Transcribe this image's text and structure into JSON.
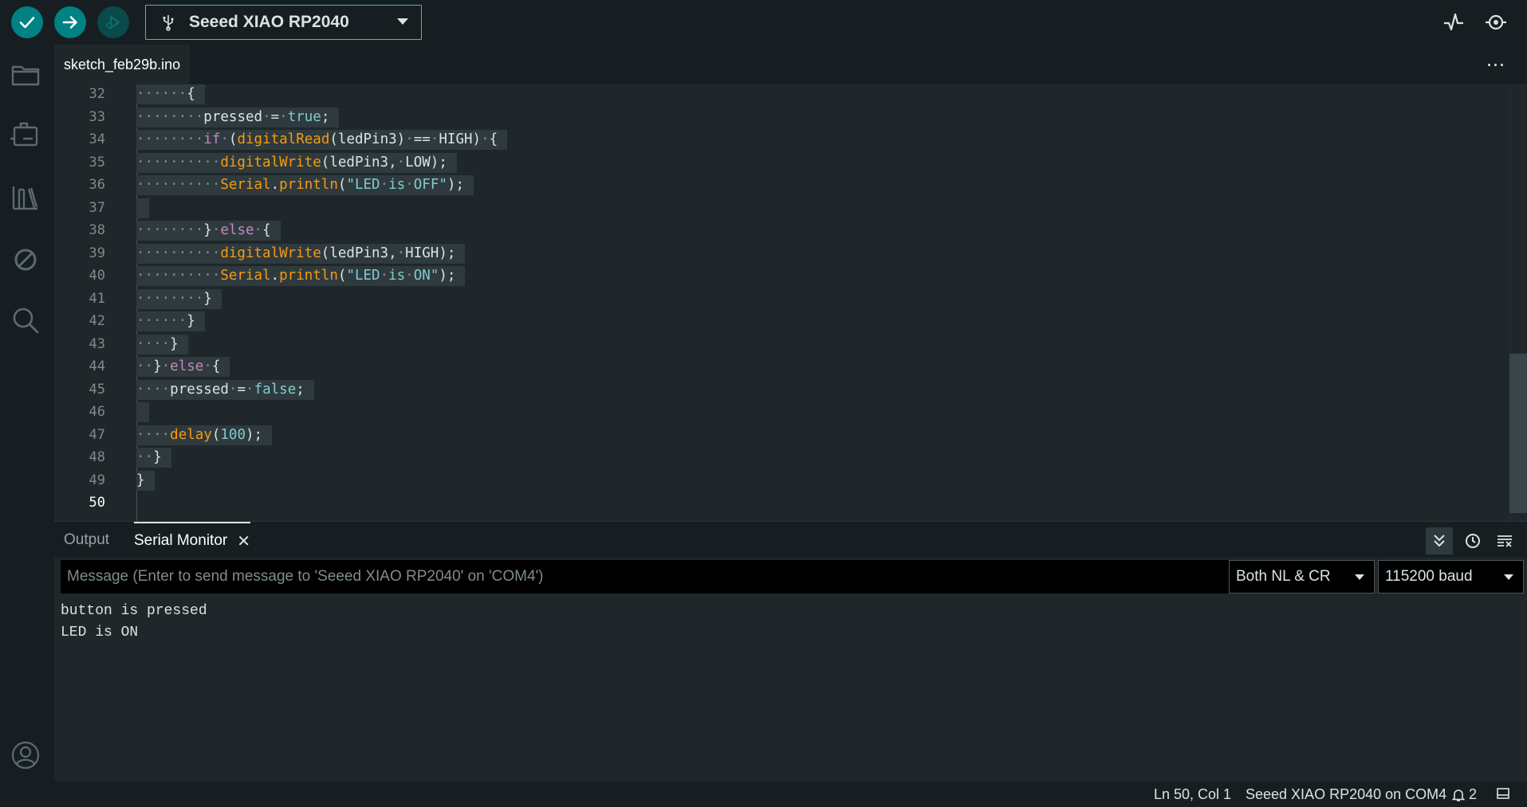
{
  "toolbar": {
    "verify_icon": "check-icon",
    "upload_icon": "arrow-right-icon",
    "debug_icon": "debug-icon",
    "board_name": "Seeed XIAO RP2040",
    "serial_plotter_icon": "pulse-icon",
    "serial_monitor_icon": "monitor-icon"
  },
  "tab": {
    "filename": "sketch_feb29b.ino",
    "more_label": "⋯"
  },
  "editor": {
    "lines": [
      {
        "num": "32",
        "html": "<span class='ws'>······</span>{"
      },
      {
        "num": "33",
        "html": "<span class='ws'>········</span>pressed<span class='ws'>·</span>=<span class='ws'>·</span><span class='lit'>true</span>;"
      },
      {
        "num": "34",
        "html": "<span class='ws'>········</span><span class='kw'>if</span><span class='ws'>·</span>(<span class='fn'>digitalRead</span>(ledPin3)<span class='ws'>·</span>==<span class='ws'>·</span>HIGH)<span class='ws'>·</span>{"
      },
      {
        "num": "35",
        "html": "<span class='ws'>··········</span><span class='fn'>digitalWrite</span>(ledPin3,<span class='ws'>·</span>LOW);"
      },
      {
        "num": "36",
        "html": "<span class='ws'>··········</span><span class='fn'>Serial</span>.<span class='fn'>println</span>(<span class='str'>\"LED<span class='ws'>·</span>is<span class='ws'>·</span>OFF\"</span>);"
      },
      {
        "num": "37",
        "html": ""
      },
      {
        "num": "38",
        "html": "<span class='ws'>········</span>}<span class='ws'>·</span><span class='kw'>else</span><span class='ws'>·</span>{"
      },
      {
        "num": "39",
        "html": "<span class='ws'>··········</span><span class='fn'>digitalWrite</span>(ledPin3,<span class='ws'>·</span>HIGH);"
      },
      {
        "num": "40",
        "html": "<span class='ws'>··········</span><span class='fn'>Serial</span>.<span class='fn'>println</span>(<span class='str'>\"LED<span class='ws'>·</span>is<span class='ws'>·</span>ON\"</span>);"
      },
      {
        "num": "41",
        "html": "<span class='ws'>········</span>}"
      },
      {
        "num": "42",
        "html": "<span class='ws'>······</span>}"
      },
      {
        "num": "43",
        "html": "<span class='ws'>····</span>}"
      },
      {
        "num": "44",
        "html": "<span class='ws'>··</span>}<span class='ws'>·</span><span class='kw'>else</span><span class='ws'>·</span>{"
      },
      {
        "num": "45",
        "html": "<span class='ws'>····</span>pressed<span class='ws'>·</span>=<span class='ws'>·</span><span class='lit'>false</span>;"
      },
      {
        "num": "46",
        "html": ""
      },
      {
        "num": "47",
        "html": "<span class='ws'>····</span><span class='fn'>delay</span>(<span class='lit'>100</span>);"
      },
      {
        "num": "48",
        "html": "<span class='ws'>··</span>}"
      },
      {
        "num": "49",
        "html": "}"
      },
      {
        "num": "50",
        "html": null
      }
    ]
  },
  "panel": {
    "output_tab": "Output",
    "serial_tab": "Serial Monitor",
    "close_glyph": "✕",
    "message_placeholder": "Message (Enter to send message to 'Seeed XIAO RP2040' on 'COM4')",
    "line_ending": "Both NL & CR",
    "baud": "115200 baud",
    "serial_output": [
      "button is pressed",
      "LED is ON"
    ]
  },
  "status": {
    "position": "Ln 50, Col 1",
    "board_port": "Seeed XIAO RP2040 on COM4",
    "notifications": "2"
  },
  "colors": {
    "accent": "#008184",
    "background": "#171e21",
    "editor_bg": "#1f272a"
  }
}
